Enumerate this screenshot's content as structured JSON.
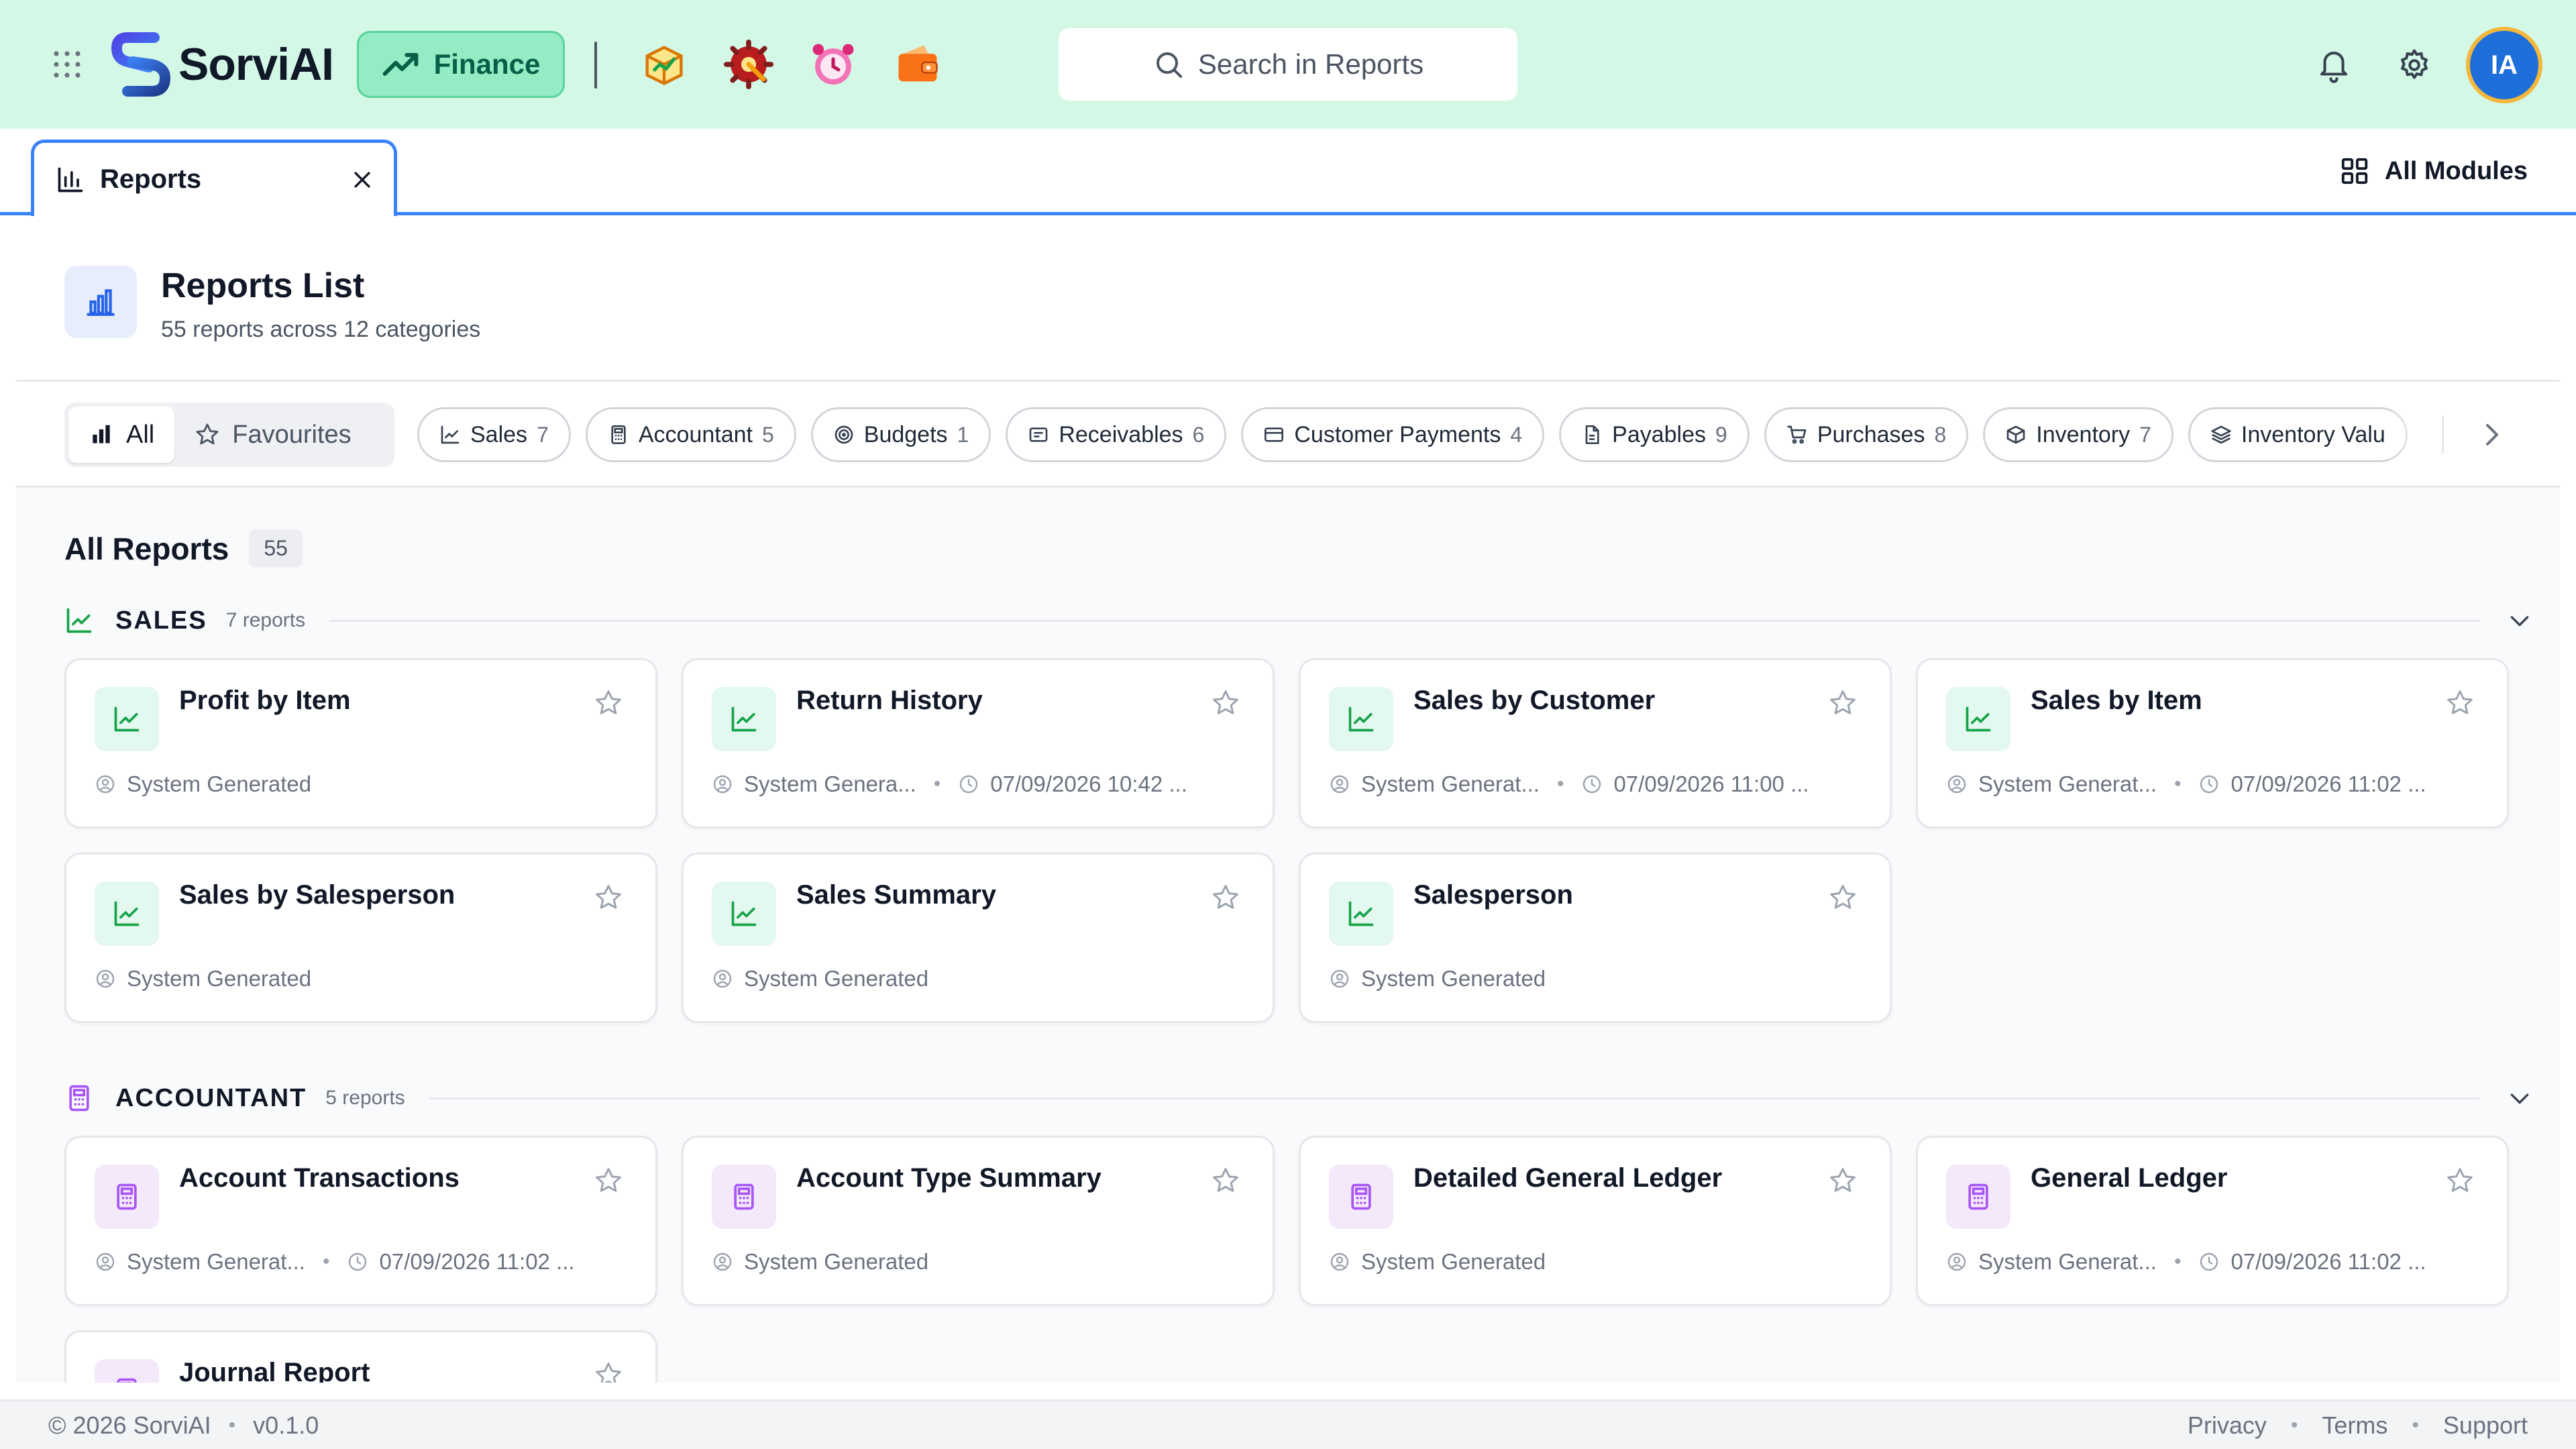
{
  "header": {
    "brand_name": "SorviAI",
    "active_module": "Finance",
    "search_placeholder": "Search in Reports",
    "avatar_initials": "IA",
    "colors": {
      "header_bg": "#d4f8e6",
      "module_pill": "#93ecc4",
      "avatar": "#1e6fd9",
      "avatar_ring": "#f5b73b"
    },
    "module_shortcuts": [
      "box-icon",
      "gear-wrench-icon",
      "alarm-clock-icon",
      "wallet-icon"
    ]
  },
  "tabs": {
    "active_tab": "Reports",
    "all_modules_label": "All Modules"
  },
  "page": {
    "title": "Reports List",
    "subtitle": "55 reports across 12 categories"
  },
  "filters": {
    "segments": [
      {
        "label": "All",
        "active": true
      },
      {
        "label": "Favourites",
        "active": false
      }
    ],
    "chips": [
      {
        "label": "Sales",
        "count": "7",
        "icon": "chart-line-icon"
      },
      {
        "label": "Accountant",
        "count": "5",
        "icon": "calculator-icon"
      },
      {
        "label": "Budgets",
        "count": "1",
        "icon": "target-icon"
      },
      {
        "label": "Receivables",
        "count": "6",
        "icon": "receipt-icon"
      },
      {
        "label": "Customer Payments",
        "count": "4",
        "icon": "credit-card-icon"
      },
      {
        "label": "Payables",
        "count": "9",
        "icon": "document-icon"
      },
      {
        "label": "Purchases",
        "count": "8",
        "icon": "cart-icon"
      },
      {
        "label": "Inventory",
        "count": "7",
        "icon": "package-icon"
      },
      {
        "label": "Inventory Valu",
        "count": "",
        "icon": "layers-icon"
      }
    ]
  },
  "content": {
    "all_reports_label": "All Reports",
    "all_reports_count": "55",
    "sections": [
      {
        "name": "SALES",
        "count_label": "7 reports",
        "color": "#16a34a",
        "cards": [
          {
            "title": "Profit by Item",
            "owner": "System Generated",
            "time": ""
          },
          {
            "title": "Return History",
            "owner": "System Genera...",
            "time": "07/09/2026 10:42 ..."
          },
          {
            "title": "Sales by Customer",
            "owner": "System Generat...",
            "time": "07/09/2026 11:00 ..."
          },
          {
            "title": "Sales by Item",
            "owner": "System Generat...",
            "time": "07/09/2026 11:02 ..."
          },
          {
            "title": "Sales by Salesperson",
            "owner": "System Generated",
            "time": ""
          },
          {
            "title": "Sales Summary",
            "owner": "System Generated",
            "time": ""
          },
          {
            "title": "Salesperson",
            "owner": "System Generated",
            "time": ""
          }
        ]
      },
      {
        "name": "ACCOUNTANT",
        "count_label": "5 reports",
        "color": "#a855f7",
        "cards": [
          {
            "title": "Account Transactions",
            "owner": "System Generat...",
            "time": "07/09/2026 11:02 ..."
          },
          {
            "title": "Account Type Summary",
            "owner": "System Generated",
            "time": ""
          },
          {
            "title": "Detailed General Ledger",
            "owner": "System Generated",
            "time": ""
          },
          {
            "title": "General Ledger",
            "owner": "System Generat...",
            "time": "07/09/2026 11:02 ..."
          },
          {
            "title": "Journal Report",
            "owner": "",
            "time": ""
          }
        ]
      }
    ]
  },
  "footer": {
    "copyright": "© 2026 SorviAI",
    "version": "v0.1.0",
    "links": [
      "Privacy",
      "Terms",
      "Support"
    ]
  }
}
